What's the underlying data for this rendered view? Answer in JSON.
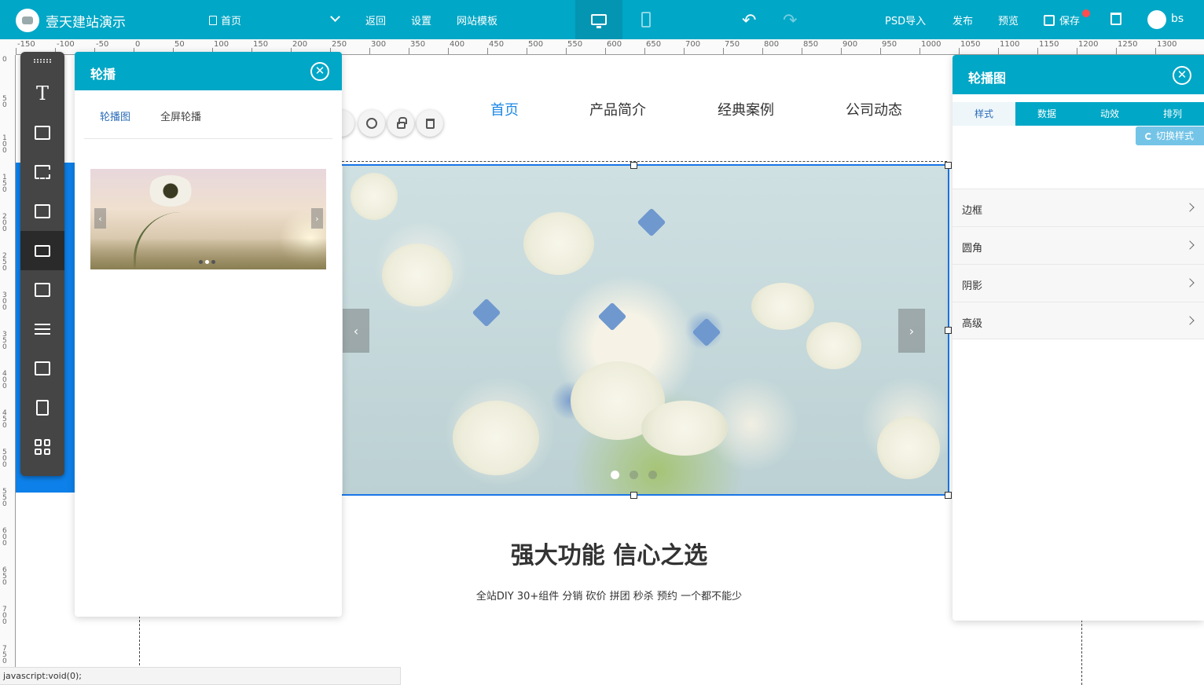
{
  "header": {
    "site_name": "壹天建站演示",
    "page_selector": "首页",
    "links": [
      "返回",
      "设置",
      "网站模板"
    ],
    "actions": {
      "psd": "PSD导入",
      "publish": "发布",
      "preview": "预览",
      "save": "保存"
    },
    "user": "bs"
  },
  "ruler": {
    "h_labels": [
      "-150",
      "-100",
      "-50",
      "0",
      "50",
      "100",
      "150",
      "200",
      "250",
      "300",
      "350",
      "400",
      "450",
      "500",
      "550",
      "600",
      "650",
      "700",
      "750",
      "800",
      "850",
      "900",
      "950",
      "1000",
      "1050",
      "1100",
      "1150",
      "1200",
      "1250",
      "1300"
    ],
    "v_labels": [
      "0",
      "50",
      "100",
      "150",
      "200",
      "250",
      "300",
      "350",
      "400",
      "450",
      "500",
      "550",
      "600",
      "650",
      "700",
      "750"
    ]
  },
  "site": {
    "nav": [
      "首页",
      "产品简介",
      "经典案例",
      "公司动态"
    ],
    "headline": "强大功能 信心之选",
    "subline": "全站DIY 30+组件 分销 砍价 拼团 秒杀 预约 一个都不能少",
    "banner_slide": 1,
    "banner_slide_count": 3
  },
  "float_toolbar": {
    "label": "轮播图"
  },
  "left_panel": {
    "title": "轮播",
    "tabs": [
      "轮播图",
      "全屏轮播"
    ]
  },
  "right_panel": {
    "title": "轮播图",
    "tabs": [
      "样式",
      "数据",
      "动效",
      "排列"
    ],
    "switch_style": "切换样式",
    "sections": [
      "边框",
      "圆角",
      "阴影",
      "高级"
    ]
  },
  "status_bar": "javascript:void(0);",
  "colors": {
    "primary": "#00a7c6",
    "selection": "#1976e8",
    "nav_active": "#1e88e5",
    "toolbar": "#454545"
  }
}
